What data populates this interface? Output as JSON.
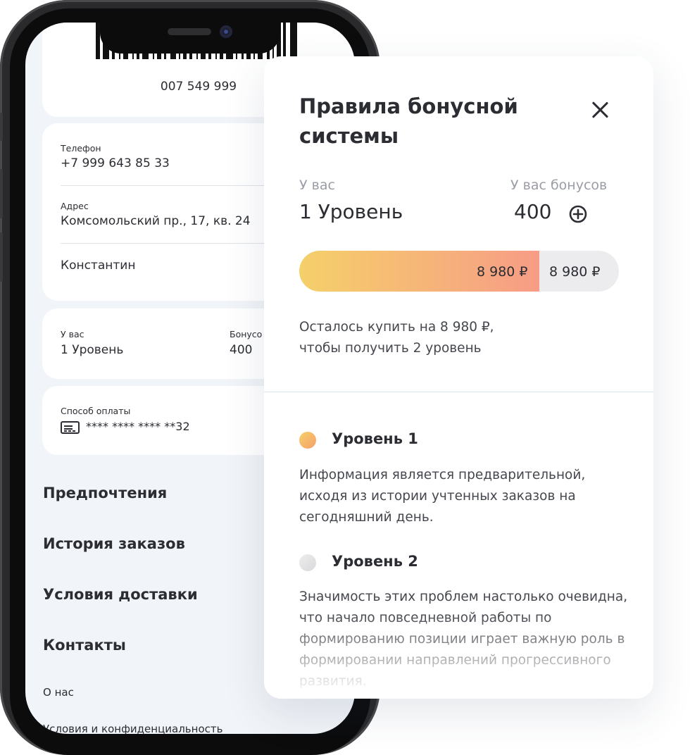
{
  "profile": {
    "card_number": "007 549 999",
    "phone_label": "Телефон",
    "phone_value": "+7 999 643 85 33",
    "address_label": "Адрес",
    "address_value": "Комсомольский пр., 17, кв. 24",
    "name_value": "Константин",
    "level_label": "У вас",
    "level_value": "1 Уровень",
    "bonus_label": "Бонусо",
    "bonus_value": "400",
    "payment_label": "Способ оплаты",
    "payment_value": "**** **** **** **32",
    "icons": {
      "card": "credit-card-icon"
    }
  },
  "menu": {
    "items": [
      "Предпочтения",
      "История заказов",
      "Условия доставки",
      "Контакты"
    ],
    "small_items": [
      "О нас",
      "Условия и конфиденциальность"
    ]
  },
  "modal": {
    "title": "Правила бонусной системы",
    "level_label": "У вас",
    "level_value": "1 Уровень",
    "bonus_label": "У вас бонусов",
    "bonus_value": "400",
    "progress": {
      "fraction": 0.75,
      "filled_label": "8 980 ₽",
      "rest_label": "8 980 ₽",
      "colors": {
        "start": "#f5d06a",
        "end": "#f79c86",
        "track": "#ececee"
      }
    },
    "remain_line1": "Осталось купить на 8 980 ₽,",
    "remain_line2": "чтобы получить 2 уровень",
    "levels": [
      {
        "title": "Уровень 1",
        "text": "Информация является предварительной, исходя из истории учтенных заказов на сегодняшний день.",
        "dot_color": "#f6a06a"
      },
      {
        "title": "Уровень 2",
        "text": "Значимость этих проблем настолько очевидна, что начало повседневной работы по формированию позиции играет важную роль в формировании направлений прогрессивного развития.",
        "dot_color": "#d9d9db"
      }
    ],
    "icons": {
      "close": "close-icon",
      "add": "plus-circle-icon"
    }
  }
}
